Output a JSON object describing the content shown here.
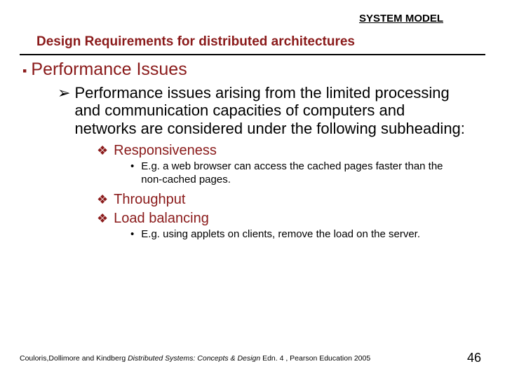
{
  "header": {
    "label": "SYSTEM MODEL"
  },
  "subtitle": "Design Requirements for distributed architectures",
  "section": {
    "title": "Performance Issues"
  },
  "intro": "Performance issues arising from the limited processing and communication capacities of computers and networks are considered under the following subheading:",
  "items": {
    "responsiveness": {
      "label": "Responsiveness",
      "example": "E.g. a web browser can access the cached pages faster than the non-cached pages."
    },
    "throughput": {
      "label": "Throughput"
    },
    "loadbalancing": {
      "label": "Load balancing",
      "example": "E.g. using applets on clients, remove the load on the server."
    }
  },
  "footer": {
    "citation_prefix": "Couloris,Dollimore and Kindberg ",
    "citation_title": "Distributed Systems: Concepts & Design",
    "citation_suffix": " Edn. 4 , Pearson Education 2005",
    "page": "46"
  }
}
